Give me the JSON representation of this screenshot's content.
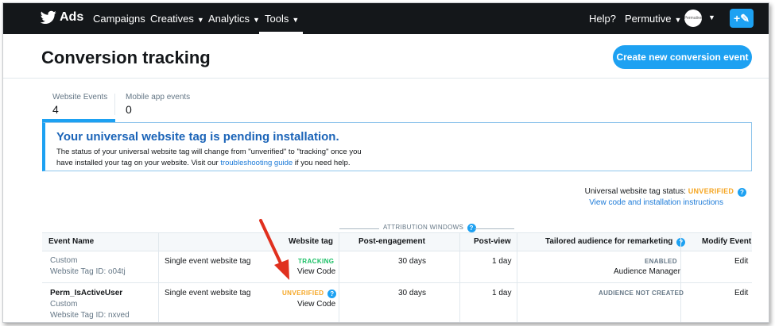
{
  "nav": {
    "logo_text": "Ads",
    "items": [
      {
        "label": "Campaigns"
      },
      {
        "label": "Creatives"
      },
      {
        "label": "Analytics"
      },
      {
        "label": "Tools"
      }
    ],
    "help": "Help?",
    "account": "Permutive",
    "avatar_text": "Permutive",
    "active_tab": "Tools"
  },
  "header": {
    "title": "Conversion tracking",
    "create_button": "Create new conversion event"
  },
  "tabs": [
    {
      "label": "Website Events",
      "count": "4",
      "active": true
    },
    {
      "label": "Mobile app events",
      "count": "0",
      "active": false
    }
  ],
  "alert": {
    "heading": "Your universal website tag is pending installation.",
    "body_1": "The status of your universal website tag will change from \"unverified\" to \"tracking\" once you have installed your tag on your website. Visit our ",
    "link": "troubleshooting guide",
    "body_2": " if you need help."
  },
  "tag_status": {
    "label": "Universal website tag status:",
    "status": "UNVERIFIED",
    "instructions_link": "View code and installation instructions"
  },
  "attribution_label": "ATTRIBUTION WINDOWS",
  "table": {
    "headers": {
      "event_name": "Event Name",
      "website_tag": "Website tag",
      "post_engagement": "Post-engagement",
      "post_view": "Post-view",
      "tailored_audience": "Tailored audience for remarketing",
      "modify": "Modify Event"
    },
    "rows": [
      {
        "name": "",
        "type": "Custom",
        "tag_id": "Website Tag ID: o04tj",
        "tag_kind": "Single event website tag",
        "status": "TRACKING",
        "view_code": "View Code",
        "post_engagement": "30 days",
        "post_view": "1 day",
        "audience": "ENABLED",
        "audience_link": "Audience Manager",
        "edit": "Edit"
      },
      {
        "name": "Perm_IsActiveUser",
        "type": "Custom",
        "tag_id": "Website Tag ID: nxved",
        "tag_kind": "Single event website tag",
        "status": "UNVERIFIED",
        "view_code": "View Code",
        "post_engagement": "30 days",
        "post_view": "1 day",
        "audience": "AUDIENCE NOT CREATED",
        "audience_link": "",
        "edit": "Edit"
      }
    ]
  },
  "colors": {
    "nav_bg": "#14171a",
    "accent": "#1da1f2",
    "tracking": "#17bf63",
    "unverified": "#f5a623",
    "annotation_arrow": "#e0301e"
  }
}
